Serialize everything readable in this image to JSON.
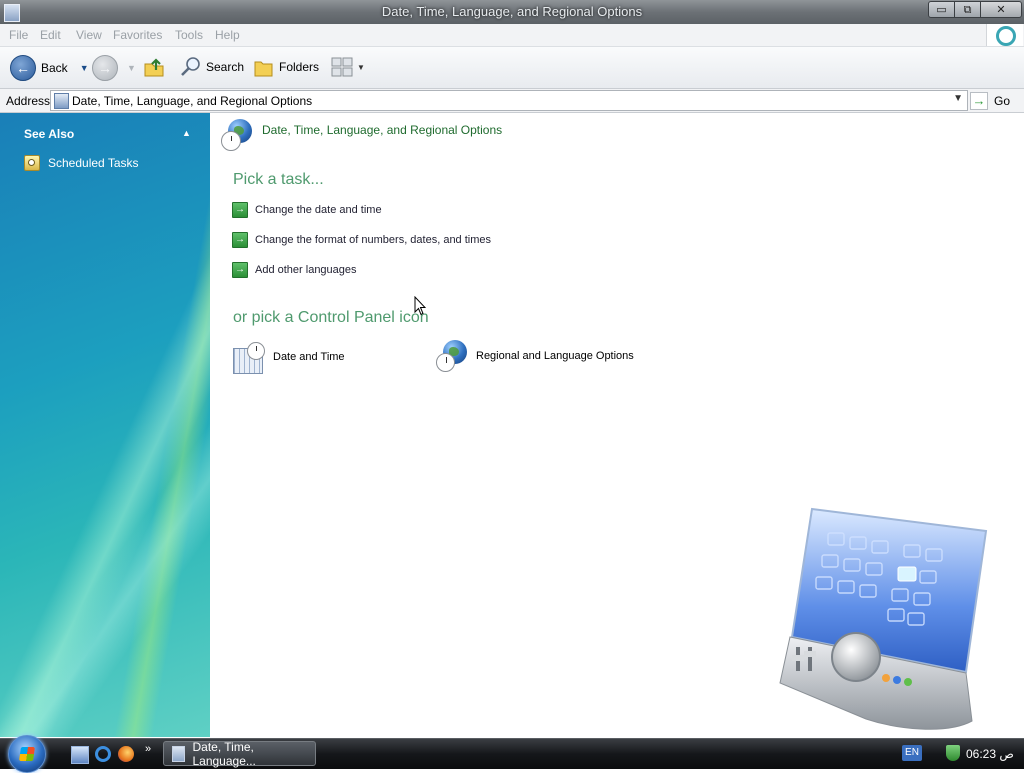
{
  "window": {
    "title": "Date, Time, Language, and Regional Options",
    "controls": {
      "minimize": "▭",
      "maximize": "⧉",
      "close": "✕"
    }
  },
  "menubar": {
    "items": [
      "File",
      "Edit",
      "View",
      "Favorites",
      "Tools",
      "Help"
    ]
  },
  "toolbar": {
    "back_label": "Back",
    "search_label": "Search",
    "folders_label": "Folders"
  },
  "addressbar": {
    "label": "Address",
    "value": "Date, Time, Language, and Regional Options",
    "go_label": "Go"
  },
  "sidebar": {
    "section_title": "See Also",
    "links": [
      "Scheduled Tasks"
    ]
  },
  "main": {
    "heading": "Date, Time, Language, and Regional Options",
    "pick_task": "Pick a task...",
    "tasks": [
      "Change the date and time",
      "Change the format of numbers, dates, and times",
      "Add other languages"
    ],
    "pick_icon": "or pick a Control Panel icon",
    "icons": [
      "Date and Time",
      "Regional and Language Options"
    ]
  },
  "taskbar": {
    "task_button": "Date, Time, Language...",
    "more_indicator": "»",
    "language": "EN",
    "clock": "06:23 ص"
  },
  "colors": {
    "accent_green": "#1f6b2e",
    "section_title_green": "#4f9a6e",
    "sidebar_blue": "#1c9fbf"
  }
}
